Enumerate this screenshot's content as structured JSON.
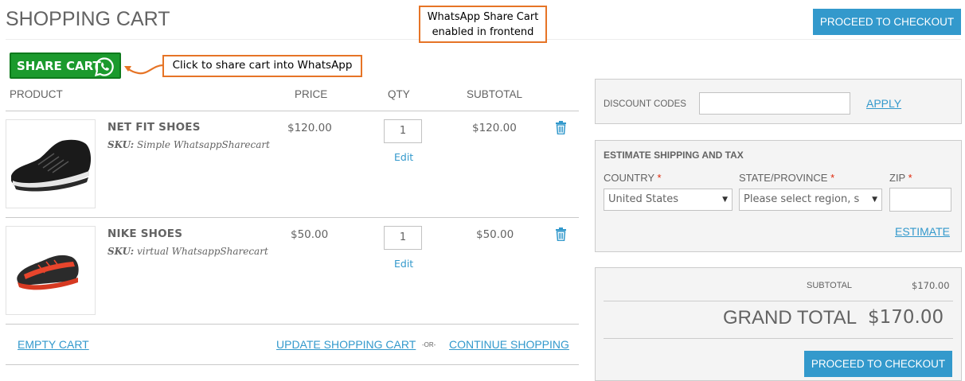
{
  "page": {
    "title": "SHOPPING CART",
    "checkout_label": "PROCEED TO CHECKOUT"
  },
  "annotations": {
    "frontend_line1": "WhatsApp Share Cart",
    "frontend_line2": "enabled in frontend",
    "share_hint": "Click to share cart into WhatsApp",
    "accent_color": "#e67426"
  },
  "share_button": {
    "label": "SHARE CART",
    "icon": "whatsapp-icon",
    "color": "#1b9a2d"
  },
  "table": {
    "headers": [
      "PRODUCT",
      "PRICE",
      "QTY",
      "SUBTOTAL"
    ],
    "items": [
      {
        "image": "black-running-shoe",
        "name": "NET FIT SHOES",
        "sku_label": "SKU:",
        "sku": "Simple WhatsappSharecart",
        "price": "$120.00",
        "qty": "1",
        "edit_label": "Edit",
        "subtotal": "$120.00",
        "remove_icon": "trash-icon"
      },
      {
        "image": "red-black-sneaker",
        "name": "NIKE SHOES",
        "sku_label": "SKU:",
        "sku": "virtual WhatsappSharecart",
        "price": "$50.00",
        "qty": "1",
        "edit_label": "Edit",
        "subtotal": "$50.00",
        "remove_icon": "trash-icon"
      }
    ],
    "empty_cart": "EMPTY CART",
    "update_cart": "UPDATE SHOPPING CART",
    "or": "-OR-",
    "continue_shopping": "CONTINUE SHOPPING"
  },
  "discount": {
    "label": "DISCOUNT CODES",
    "value": "",
    "apply": "APPLY"
  },
  "shipping": {
    "title": "ESTIMATE SHIPPING AND TAX",
    "country_label": "COUNTRY",
    "country_value": "United States",
    "state_label": "STATE/PROVINCE",
    "state_value": "Please select region, s",
    "zip_label": "ZIP",
    "zip_value": "",
    "required_mark": "*",
    "estimate": "ESTIMATE"
  },
  "totals": {
    "subtotal_label": "SUBTOTAL",
    "subtotal_value": "$170.00",
    "grand_label": "GRAND TOTAL",
    "grand_value": "$170.00"
  },
  "colors": {
    "primary": "#3399cc",
    "text": "#636363",
    "required": "#df280a",
    "panel_bg": "#f4f4f4"
  }
}
